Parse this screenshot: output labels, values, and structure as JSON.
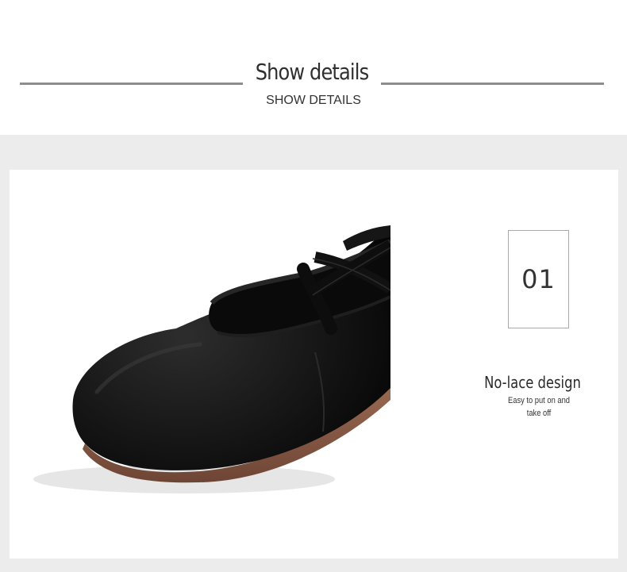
{
  "header": {
    "title": "Show details",
    "subtitle": "SHOW DETAILS"
  },
  "detail": {
    "number": "01",
    "feature_title": "No-lace design",
    "feature_description": "Easy to put on and take off",
    "image_subject": "black canvas ballet shoe"
  },
  "colors": {
    "rule": "#8e8e8e",
    "band_background": "#ececec",
    "card_background": "#ffffff",
    "text_dark": "#2f2f2f"
  }
}
